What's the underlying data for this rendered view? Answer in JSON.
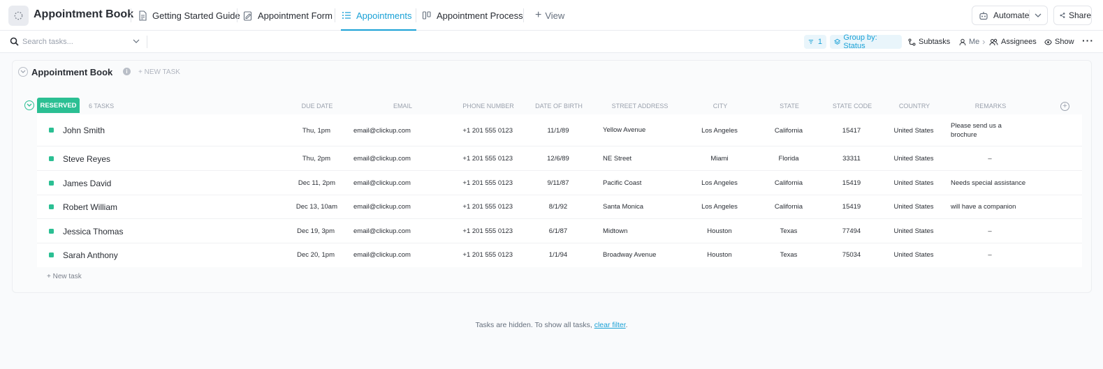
{
  "header": {
    "title": "Appointment Book",
    "tabs": [
      {
        "label": "Getting Started Guide",
        "active": false,
        "icon": "doc-icon"
      },
      {
        "label": "Appointment Form",
        "active": false,
        "icon": "form-icon"
      },
      {
        "label": "Appointments",
        "active": true,
        "icon": "list-icon"
      },
      {
        "label": "Appointment Process",
        "active": false,
        "icon": "board-icon"
      }
    ],
    "add_view_label": "View",
    "automate_label": "Automate",
    "share_label": "Share"
  },
  "toolbar": {
    "search_placeholder": "Search tasks...",
    "filter_count": "1",
    "group_by_label": "Group by: Status",
    "subtasks_label": "Subtasks",
    "me_label": "Me",
    "assignees_label": "Assignees",
    "show_label": "Show"
  },
  "list": {
    "title": "Appointment Book",
    "new_task_header": "+ NEW TASK",
    "group": {
      "status": "RESERVED",
      "count_label": "6 TASKS",
      "status_color": "#2bbf93"
    },
    "columns": {
      "due_date": "DUE DATE",
      "email": "EMAIL",
      "phone": "PHONE NUMBER",
      "dob": "DATE OF BIRTH",
      "street": "STREET ADDRESS",
      "city": "CITY",
      "state": "STATE",
      "state_code": "STATE CODE",
      "country": "COUNTRY",
      "remarks": "REMARKS"
    },
    "rows": [
      {
        "name": "John Smith",
        "due": "Thu, 1pm",
        "email": "email@clickup.com",
        "phone": "+1 201 555 0123",
        "dob": "11/1/89",
        "street": "Yellow Avenue",
        "city": "Los Angeles",
        "state": "California",
        "code": "15417",
        "country": "United States",
        "remarks": "Please send us a brochure"
      },
      {
        "name": "Steve Reyes",
        "due": "Thu, 2pm",
        "email": "email@clickup.com",
        "phone": "+1 201 555 0123",
        "dob": "12/6/89",
        "street": "NE Street",
        "city": "Miami",
        "state": "Florida",
        "code": "33311",
        "country": "United States",
        "remarks": "–"
      },
      {
        "name": "James David",
        "due": "Dec 11, 2pm",
        "email": "email@clickup.com",
        "phone": "+1 201 555 0123",
        "dob": "9/11/87",
        "street": "Pacific Coast",
        "city": "Los Angeles",
        "state": "California",
        "code": "15419",
        "country": "United States",
        "remarks": "Needs special assistance"
      },
      {
        "name": "Robert William",
        "due": "Dec 13, 10am",
        "email": "email@clickup.com",
        "phone": "+1 201 555 0123",
        "dob": "8/1/92",
        "street": "Santa Monica",
        "city": "Los Angeles",
        "state": "California",
        "code": "15419",
        "country": "United States",
        "remarks": "will have a companion"
      },
      {
        "name": "Jessica Thomas",
        "due": "Dec 19, 3pm",
        "email": "email@clickup.com",
        "phone": "+1 201 555 0123",
        "dob": "6/1/87",
        "street": "Midtown",
        "city": "Houston",
        "state": "Texas",
        "code": "77494",
        "country": "United States",
        "remarks": "–"
      },
      {
        "name": "Sarah Anthony",
        "due": "Dec 20, 1pm",
        "email": "email@clickup.com",
        "phone": "+1 201 555 0123",
        "dob": "1/1/94",
        "street": "Broadway Avenue",
        "city": "Houston",
        "state": "Texas",
        "code": "75034",
        "country": "United States",
        "remarks": "–"
      }
    ],
    "new_task_footer": "+ New task"
  },
  "hidden_notice": {
    "text": "Tasks are hidden. To show all tasks, ",
    "link": "clear filter",
    "suffix": "."
  }
}
